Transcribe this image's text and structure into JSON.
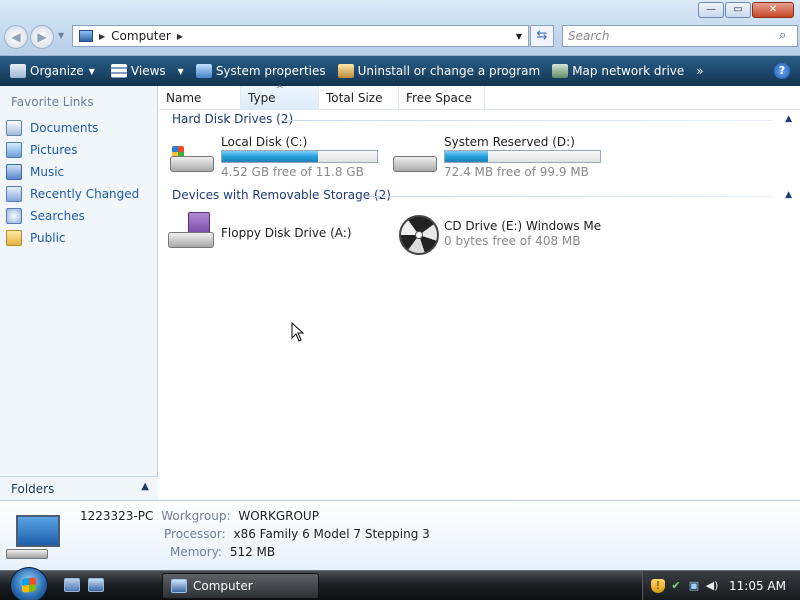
{
  "window": {
    "controls": {
      "minimize": "—",
      "maximize": "▭",
      "close": "✕"
    }
  },
  "address": {
    "location": "Computer",
    "search_placeholder": "Search"
  },
  "command_bar": {
    "organize": "Organize",
    "views": "Views",
    "system_properties": "System properties",
    "uninstall": "Uninstall or change a program",
    "map_drive": "Map network drive",
    "more": "»",
    "help": "?"
  },
  "sidebar": {
    "title": "Favorite Links",
    "items": [
      {
        "label": "Documents",
        "icon": "documents-icon"
      },
      {
        "label": "Pictures",
        "icon": "pictures-icon"
      },
      {
        "label": "Music",
        "icon": "music-icon"
      },
      {
        "label": "Recently Changed",
        "icon": "recently-changed-icon"
      },
      {
        "label": "Searches",
        "icon": "searches-icon"
      },
      {
        "label": "Public",
        "icon": "public-folder-icon"
      }
    ],
    "folders_label": "Folders"
  },
  "columns": [
    "Name",
    "Type",
    "Total Size",
    "Free Space"
  ],
  "groups": {
    "hard_disk": "Hard Disk Drives (2)",
    "removable": "Devices with Removable Storage (2)"
  },
  "drives": {
    "c": {
      "name": "Local Disk (C:)",
      "free": "4.52 GB free of 11.8 GB",
      "used_fraction": 0.62
    },
    "d": {
      "name": "System Reserved (D:)",
      "free": "72.4 MB free of 99.9 MB",
      "used_fraction": 0.28
    },
    "a": {
      "name": "Floppy Disk Drive (A:)"
    },
    "e": {
      "name": "CD Drive (E:) Windows Me",
      "free": "0 bytes free of 408 MB"
    }
  },
  "details": {
    "computer_name": "1223323-PC",
    "workgroup_label": "Workgroup:",
    "workgroup": "WORKGROUP",
    "processor_label": "Processor:",
    "processor": "x86 Family 6 Model 7 Stepping 3",
    "memory_label": "Memory:",
    "memory": "512 MB"
  },
  "taskbar": {
    "active_window": "Computer",
    "clock": "11:05 AM"
  },
  "colors": {
    "command_bar": "#1d4a6e",
    "link": "#1d5aa6",
    "progress": "#26a0da"
  }
}
